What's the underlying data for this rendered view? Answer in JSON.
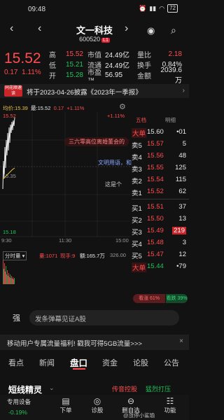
{
  "status": {
    "time": "09:48",
    "battery": "72"
  },
  "header": {
    "title": "文一科技",
    "code": "600520",
    "badge": "L1"
  },
  "quote": {
    "price": "15.52",
    "change": "0.17",
    "change_pct": "1.11%",
    "rows": [
      {
        "l": "高",
        "v": "15.52",
        "k": "市值",
        "w": "24.49亿",
        "k2": "量比",
        "r": "2.18"
      },
      {
        "l": "低",
        "v": "15.21",
        "k": "流通",
        "w": "24.49亿",
        "k2": "换手",
        "r": "0.84%"
      },
      {
        "l": "开",
        "v": "15.28",
        "k": "市盈™",
        "w": "56.95",
        "k2": "金额",
        "r": "2039.6万"
      }
    ]
  },
  "banner": {
    "badge": "同花顺速读",
    "text": "将于2023-04-26披露《2023年一季报》"
  },
  "chart": {
    "avg_label": "均价:15.39",
    "last_label": "最:15.52",
    "chg": "0.17",
    "pct": "+1.11%",
    "top_left": "15.52",
    "mid_left": "15.35",
    "bottom_left": "15.18",
    "top_right": "+1.11%",
    "x_start": "9:30",
    "x_mid": "11:30",
    "x_end": "15:00",
    "danmaku": [
      "三六零高位离婚董会的",
      "文明用语，和",
      "这是个"
    ],
    "indicator": "分时量",
    "vol_label": "量:1071",
    "hand_label": "现手:9",
    "amt_label": "额:165.7万",
    "vol_right": "326.00"
  },
  "book": {
    "tab1": "五档",
    "tab2": "明细",
    "rows": [
      {
        "l": "大单",
        "p": "15.60",
        "v": "•01",
        "type": "bigsell"
      },
      {
        "l": "卖5",
        "p": "15.57",
        "v": "5",
        "type": "sell"
      },
      {
        "l": "卖4",
        "p": "15.56",
        "v": "48",
        "type": "sell"
      },
      {
        "l": "卖3",
        "p": "15.55",
        "v": "125",
        "type": "sell"
      },
      {
        "l": "卖2",
        "p": "15.54",
        "v": "115",
        "type": "sell"
      },
      {
        "l": "卖1",
        "p": "15.52",
        "v": "62",
        "type": "sell"
      },
      {
        "l": "买1",
        "p": "15.51",
        "v": "37",
        "type": "buy"
      },
      {
        "l": "买2",
        "p": "15.50",
        "v": "13",
        "type": "buy"
      },
      {
        "l": "买3",
        "p": "15.49",
        "v": "219",
        "type": "buy"
      },
      {
        "l": "买4",
        "p": "15.48",
        "v": "3",
        "type": "buy"
      },
      {
        "l": "买5",
        "p": "15.47",
        "v": "12",
        "type": "buy"
      },
      {
        "l": "大单",
        "p": "15.44",
        "v": "•79",
        "type": "bigbuy"
      }
    ],
    "bull": "看涨 61%",
    "bear": "看跌 39%"
  },
  "barrage": {
    "strong": "强",
    "placeholder": "发条弹幕见证A股"
  },
  "promo": {
    "text": "移动用户专属流量福利! 戳我可得5GB流量>>>"
  },
  "nav": {
    "tabs": [
      "看点",
      "新闻",
      "盘口",
      "资金",
      "论股",
      "公告"
    ]
  },
  "shortline": {
    "title": "短线精灵",
    "tag1": "传音控股",
    "tag2": "猛烈打压"
  },
  "bottom": {
    "left_label": "专用设备",
    "left_value": "-0.19%",
    "items": [
      "下单",
      "诊股",
      "删自选",
      "功能"
    ],
    "watermark": "@涨停小鲨瑜"
  },
  "colors": {
    "up": "#ff4d4f",
    "down": "#20c35a",
    "bg": "#121212",
    "avg": "#e8c24a"
  }
}
